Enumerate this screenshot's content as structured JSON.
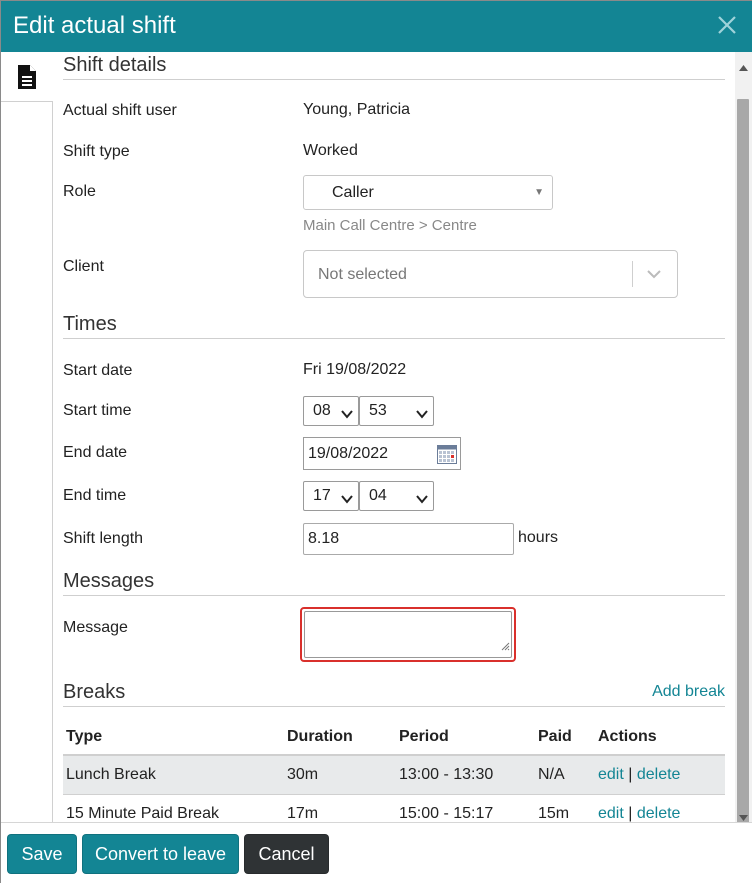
{
  "dialog": {
    "title": "Edit actual shift"
  },
  "colors": {
    "accent": "#138594",
    "cancel": "#2f3335",
    "error_border": "#d9302c"
  },
  "icons": {
    "close": "close-icon",
    "tab": "document-icon",
    "calendar": "calendar-icon",
    "chevron": "chevron-down-icon"
  },
  "shift_details": {
    "heading": "Shift details",
    "user_label": "Actual shift user",
    "user_value": "Young, Patricia",
    "type_label": "Shift type",
    "type_value": "Worked",
    "role_label": "Role",
    "role_value": "Caller",
    "role_caret": "▼",
    "role_path": "Main Call Centre > Centre",
    "client_label": "Client",
    "client_placeholder": "Not selected"
  },
  "times": {
    "heading": "Times",
    "start_date_label": "Start date",
    "start_date_value": "Fri 19/08/2022",
    "start_time_label": "Start time",
    "start_hour": "08",
    "start_minute": "53",
    "end_date_label": "End date",
    "end_date_value": "19/08/2022",
    "end_time_label": "End time",
    "end_hour": "17",
    "end_minute": "04",
    "length_label": "Shift length",
    "length_value": "8.18",
    "length_unit": "hours"
  },
  "messages": {
    "heading": "Messages",
    "message_label": "Message",
    "message_value": ""
  },
  "breaks": {
    "heading": "Breaks",
    "add_link": "Add break",
    "columns": [
      "Type",
      "Duration",
      "Period",
      "Paid",
      "Actions"
    ],
    "rows": [
      {
        "type": "Lunch Break",
        "duration": "30m",
        "period": "13:00 - 13:30",
        "paid": "N/A",
        "edit": "edit",
        "sep": "|",
        "delete": "delete"
      },
      {
        "type": "15 Minute Paid Break",
        "duration": "17m",
        "period": "15:00 - 15:17",
        "paid": "15m",
        "edit": "edit",
        "sep": "|",
        "delete": "delete"
      }
    ]
  },
  "footer": {
    "save": "Save",
    "convert": "Convert to leave",
    "cancel": "Cancel"
  }
}
